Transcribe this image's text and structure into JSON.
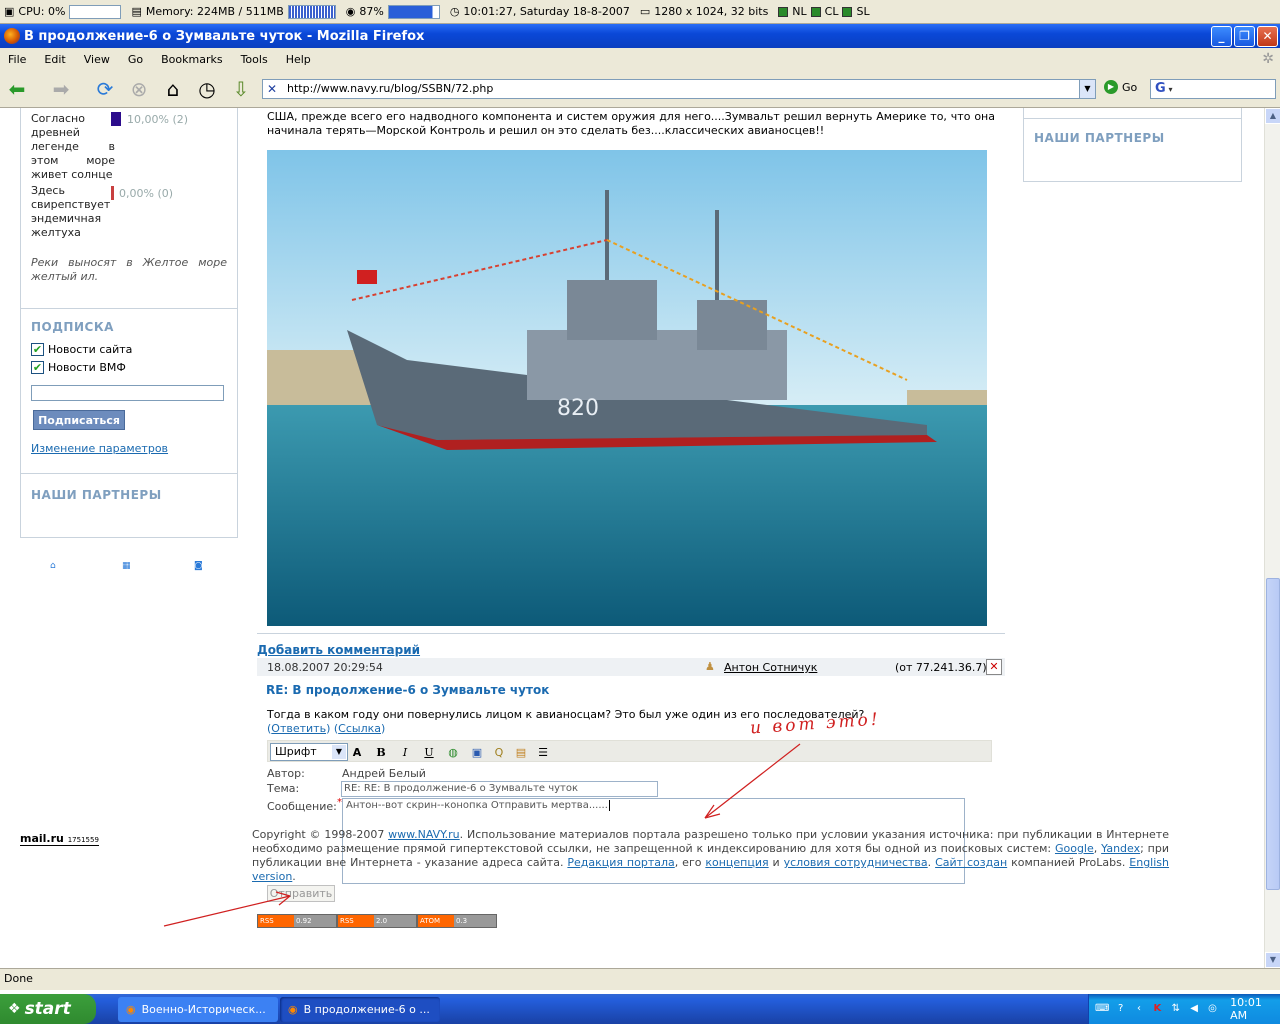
{
  "sysbar": {
    "cpu": "CPU: 0%",
    "memory": "Memory: 224MB / 511MB",
    "battery": "87%",
    "datetime": "10:01:27, Saturday 18-8-2007",
    "display": "1280 x 1024, 32 bits",
    "langs": [
      "NL",
      "CL",
      "SL"
    ]
  },
  "window": {
    "title": "В продолжение-6 о Зумвальте чуток - Mozilla Firefox"
  },
  "menu": [
    "File",
    "Edit",
    "View",
    "Go",
    "Bookmarks",
    "Tools",
    "Help"
  ],
  "nav": {
    "url": "http://www.navy.ru/blog/SSBN/72.php",
    "go_label": "Go",
    "search_logo": "G"
  },
  "poll": {
    "options": [
      {
        "label": "Согласно древней легенде в этом море живет солнце",
        "pct": "10,00% (2)",
        "value": 10,
        "color": "#2c0c8c"
      },
      {
        "label": "Здесь свирепствует эндемичная желтуха",
        "pct": "0,00% (0)",
        "value": 0,
        "color": "#c84040"
      }
    ],
    "note": "Реки выносят в Желтое море желтый ил."
  },
  "subscribe": {
    "heading": "ПОДПИСКА",
    "opt1": "Новости сайта",
    "opt2": "Новости ВМФ",
    "button": "Подписаться",
    "change_link": "Изменение параметров"
  },
  "partners_heading": "НАШИ ПАРТНЕРЫ",
  "article": {
    "text_top": "США, прежде всего его надводного компонента и систем оружия для него....Зумвальт решил вернуть Америке то, что она начинала терять—Морской Контроль и решил он это сделать без....классических авианосцев!!",
    "ship_number": "820"
  },
  "comments": {
    "add_link": "Добавить комментарий",
    "date": "18.08.2007 20:29:54",
    "author": "Антон Сотничук",
    "ip": "(от 77.241.36.7)",
    "title": "RE: В продолжение-6 о Зумвальте чуток",
    "text": "Тогда в каком году они повернулись лицом к авианосцам? Это был уже один из его последователей?",
    "reply_link": "Ответить",
    "link_link": "Ссылка"
  },
  "form": {
    "font_select": "Шрифт",
    "author_label": "Автор:",
    "author_value": "Андрей Белый",
    "subject_label": "Тема:",
    "subject_value": "RE: RE: В продолжение-6 о Зумвальте чуток",
    "message_label": "Сообщение:",
    "message_value": "Антон--вот скрин--конопка Отправить мертва......",
    "submit": "Отправить"
  },
  "annotation": "и вот это!",
  "footer": {
    "c1": "Copyright © 1998-2007 ",
    "site": "www.NAVY.ru",
    "c2": ". Использование материалов портала разрешено только при условии указания источника: при публикации в Интернете необходимо размещение прямой гипертекстовой ссылки, не запрещенной к индексированию для хотя бы одной из поисковых систем: ",
    "google": "Google",
    "c3": ", ",
    "yandex": "Yandex",
    "c4": "; при публикации вне Интернета - указание адреса сайта. ",
    "redaction": "Редакция портала",
    "c5": ", его ",
    "concept": "концепция",
    "c6": " и ",
    "terms": "условия сотрудничества",
    "c7": ". ",
    "made": "Сайт создан",
    "c8": " компанией ProLabs. ",
    "english": "English version",
    "c9": "."
  },
  "counter": {
    "logo": "mail.ru",
    "count": "1751559"
  },
  "rss": [
    {
      "a": "RSS",
      "b": "0.92"
    },
    {
      "a": "RSS",
      "b": "2.0"
    },
    {
      "a": "ATOM",
      "b": "0.3"
    }
  ],
  "status": "Done",
  "taskbar": {
    "start": "start",
    "tasks": [
      "Военно-Историческ...",
      "В продолжение-6 о ..."
    ],
    "clock": "10:01 AM"
  }
}
